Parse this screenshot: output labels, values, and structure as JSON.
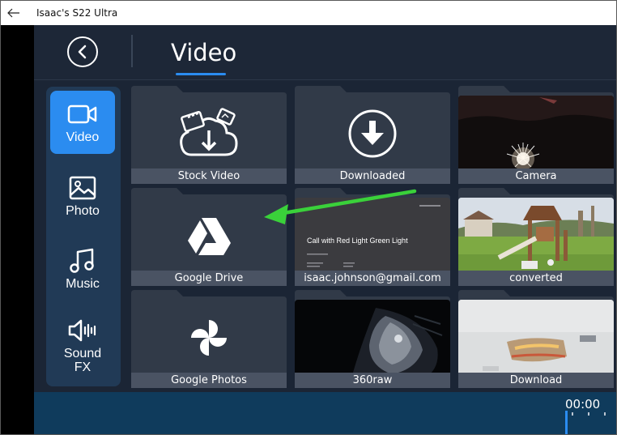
{
  "window": {
    "title": "Isaac's S22 Ultra"
  },
  "header": {
    "title": "Video"
  },
  "sidebar": {
    "items": [
      {
        "label": "Video",
        "icon": "video-camera-icon",
        "active": true
      },
      {
        "label": "Photo",
        "icon": "image-icon",
        "active": false
      },
      {
        "label": "Music",
        "icon": "music-note-icon",
        "active": false
      },
      {
        "label": "Sound FX",
        "icon": "speaker-icon",
        "active": false
      }
    ]
  },
  "tiles": [
    {
      "caption": "Stock Video",
      "icon": "cloud-media-icon"
    },
    {
      "caption": "Downloaded",
      "icon": "download-icon"
    },
    {
      "caption": "Camera",
      "icon": "fireworks-thumbnail"
    },
    {
      "caption": "Google Drive",
      "icon": "google-drive-icon"
    },
    {
      "caption": "isaac.johnson@gmail.com",
      "icon": "slide-thumbnail",
      "slide_title": "Call with Red Light Green Light"
    },
    {
      "caption": "converted",
      "icon": "playground-thumbnail"
    },
    {
      "caption": "Google Photos",
      "icon": "google-photos-icon"
    },
    {
      "caption": "360raw",
      "icon": "fisheye-thumbnail"
    },
    {
      "caption": "Download",
      "icon": "blurry-thumbnail"
    }
  ],
  "timeline": {
    "time": "00:00"
  },
  "colors": {
    "accent": "#2b8cf0",
    "arrow": "#3ad13a",
    "background": "#1b2535"
  }
}
